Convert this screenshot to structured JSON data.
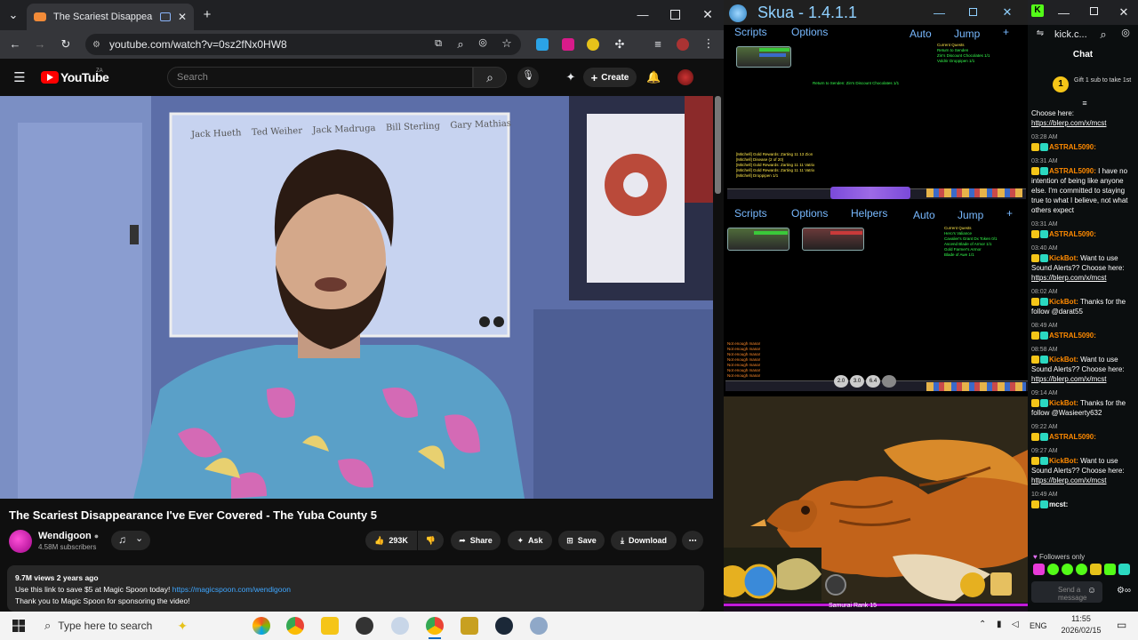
{
  "chrome": {
    "tab_title": "The Scariest Disappearance",
    "url": "youtube.com/watch?v=0sz2fNx0HW8"
  },
  "youtube": {
    "logo_text": "YouTube",
    "country": "ZA",
    "search_placeholder": "Search",
    "create_label": "Create",
    "whiteboard_names": [
      "Jack Hueth",
      "Ted Weiher",
      "Jack Madruga",
      "Bill Sterling",
      "Gary Mathias"
    ],
    "video_title": "The Scariest Disappearance I've Ever Covered - The Yuba County 5",
    "channel_name": "Wendigoon",
    "subscribers": "4.58M subscribers",
    "like_count": "293K",
    "share_label": "Share",
    "ask_label": "Ask",
    "save_label": "Save",
    "download_label": "Download",
    "views_age": "9.7M views  2 years ago",
    "desc_line1": "Use this link to save $5 at Magic Spoon today! ",
    "desc_link": "https://magicspoon.com/wendigoon",
    "desc_line2": "Thank you to Magic Spoon for sponsoring the video!"
  },
  "skua": {
    "title": "Skua - 1.4.1.1",
    "menu_top": {
      "scripts": "Scripts",
      "options": "Options",
      "auto": "Auto",
      "jump": "Jump",
      "plus": "+"
    },
    "menu_mid": {
      "scripts": "Scripts",
      "options": "Options",
      "helpers": "Helpers",
      "auto": "Auto",
      "jump": "Jump",
      "plus": "+"
    },
    "quest_header": "Current Quests",
    "rank_text": "Samurai Rank 15",
    "skill_labels": [
      "2.0",
      "3.0",
      "6.4"
    ]
  },
  "kick": {
    "url": "kick.c...",
    "chat_title": "Chat",
    "gift_text": "Gift 1 sub to take 1st",
    "messages": [
      {
        "time": "",
        "user": "",
        "user_color": "#ffffff",
        "text": "Choose here:",
        "link": "https://blerp.com/x/mcst"
      },
      {
        "time": "03:28 AM",
        "user": "ASTRAL5090:",
        "user_color": "#ff8a00",
        "text": "",
        "link": ""
      },
      {
        "time": "03:31 AM",
        "user": "ASTRAL5090:",
        "user_color": "#ff8a00",
        "text": "I have no intention of being like anyone else. I'm committed to staying true to what I believe, not what others expect",
        "link": ""
      },
      {
        "time": "03:31 AM",
        "user": "ASTRAL5090:",
        "user_color": "#ff8a00",
        "text": "",
        "link": ""
      },
      {
        "time": "03:40 AM",
        "user": "KickBot:",
        "user_color": "#ff8a00",
        "text": "Want to use Sound Alerts?? Choose here:",
        "link": "https://blerp.com/x/mcst"
      },
      {
        "time": "08:02 AM",
        "user": "KickBot:",
        "user_color": "#ff8a00",
        "text": "Thanks for the follow @darat55",
        "link": ""
      },
      {
        "time": "08:49 AM",
        "user": "ASTRAL5090:",
        "user_color": "#ff8a00",
        "text": "",
        "link": ""
      },
      {
        "time": "08:58 AM",
        "user": "KickBot:",
        "user_color": "#ff8a00",
        "text": "Want to use Sound Alerts?? Choose here:",
        "link": "https://blerp.com/x/mcst"
      },
      {
        "time": "09:14 AM",
        "user": "KickBot:",
        "user_color": "#ff8a00",
        "text": "Thanks for the follow @Wasieerty632",
        "link": ""
      },
      {
        "time": "09:22 AM",
        "user": "ASTRAL5090:",
        "user_color": "#ff8a00",
        "text": "",
        "link": ""
      },
      {
        "time": "09:27 AM",
        "user": "KickBot:",
        "user_color": "#ff8a00",
        "text": "Want to use Sound Alerts?? Choose here:",
        "link": "https://blerp.com/x/mcst"
      },
      {
        "time": "10:49 AM",
        "user": "mcst:",
        "user_color": "#ffffff",
        "text": "",
        "link": ""
      }
    ],
    "followers_only": "Followers only",
    "send_placeholder": "Send a message"
  },
  "taskbar": {
    "search_placeholder": "Type here to search",
    "lang": "ENG",
    "time": "11:55",
    "date": "2026/02/15"
  },
  "colors": {
    "yt_red": "#ff0000",
    "kick_green": "#53fc18",
    "link_blue": "#3ea6ff",
    "chat_user_orange": "#ff8a00"
  }
}
